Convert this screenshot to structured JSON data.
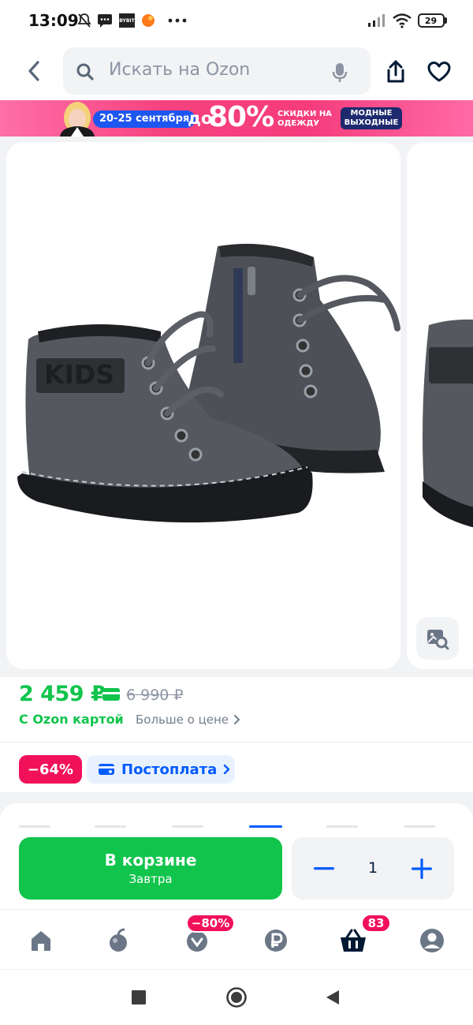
{
  "status_bar": {
    "time": "13:09",
    "carrier_badge": "BYBIT",
    "battery": "29"
  },
  "header": {
    "search_placeholder": "Искать на Ozon"
  },
  "banner": {
    "dates": "20-25 сентября",
    "upto": "до",
    "percent": "80%",
    "subtitle": "СКИДКИ НА ОДЕЖДУ",
    "tag": "МОДНЫЕ ВЫХОДНЫЕ"
  },
  "product": {
    "image_text": "KIDS",
    "price_current": "2 459 ₽",
    "price_old": "6 990 ₽",
    "ozon_card_label": "С Ozon картой",
    "price_more": "Больше о цене",
    "discount": "−64%",
    "postpay": "Постоплата"
  },
  "cart": {
    "title": "В корзине",
    "subtitle": "Завтра",
    "quantity": "1"
  },
  "bottom_nav": {
    "sale_badge": "−80%",
    "cart_badge": "83"
  },
  "colors": {
    "brand_blue": "#005bff",
    "price_green": "#10c44c",
    "badge_pink": "#f1115a"
  }
}
